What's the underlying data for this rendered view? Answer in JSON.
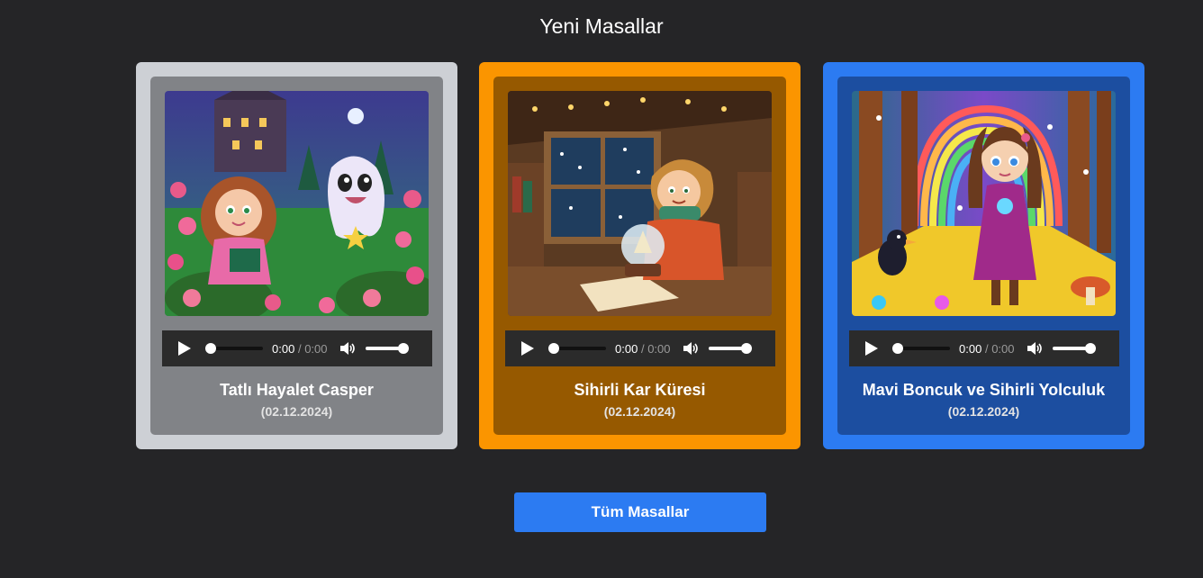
{
  "section": {
    "title": "Yeni Masallar"
  },
  "stories": [
    {
      "title": "Tatlı Hayalet Casper",
      "date": "(02.12.2024)",
      "image_icon": "ghost-garden-illustration",
      "player": {
        "current": "0:00",
        "separator": "/",
        "duration": "0:00"
      }
    },
    {
      "title": "Sihirli Kar Küresi",
      "date": "(02.12.2024)",
      "image_icon": "snow-globe-attic-illustration",
      "player": {
        "current": "0:00",
        "separator": "/",
        "duration": "0:00"
      }
    },
    {
      "title": "Mavi Boncuk ve Sihirli Yolculuk",
      "date": "(02.12.2024)",
      "image_icon": "magic-forest-illustration",
      "player": {
        "current": "0:00",
        "separator": "/",
        "duration": "0:00"
      }
    }
  ],
  "footer": {
    "all_button_label": "Tüm Masallar"
  },
  "colors": {
    "background": "#252527",
    "card_1": "#cdd0d5",
    "card_2": "#fb9500",
    "card_3": "#2c7bf2",
    "button": "#2c7bf2"
  }
}
